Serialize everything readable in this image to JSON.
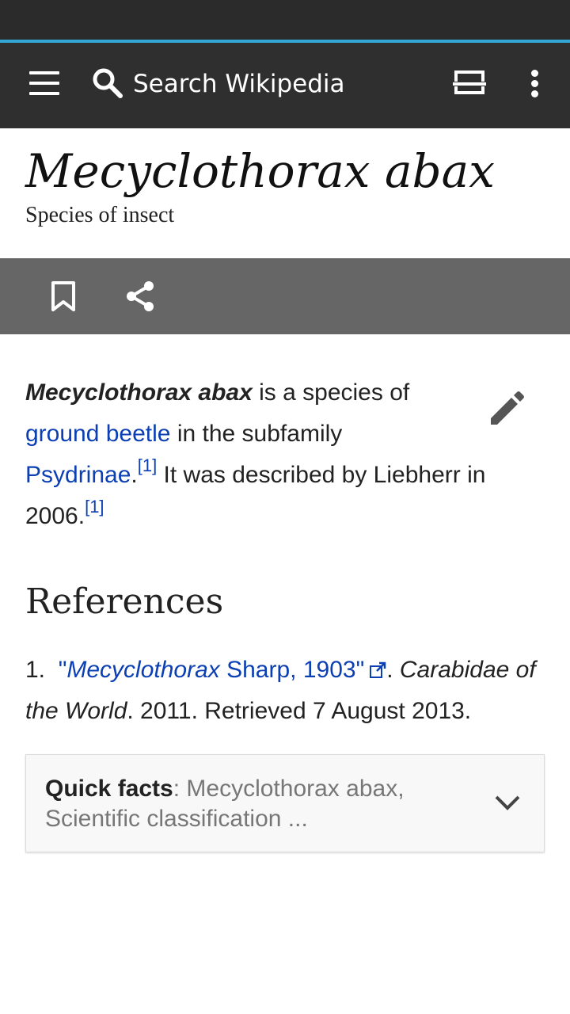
{
  "toolbar": {
    "search_placeholder": "Search Wikipedia"
  },
  "article": {
    "title": "Mecyclothorax abax",
    "description": "Species of insect",
    "intro": {
      "bold_name": "Mecyclothorax abax",
      "text1": " is a species of",
      "link_ground_beetle": "ground beetle",
      "text2": " in the subfamily",
      "link_psydrinae": "Psydrinae",
      "period1": ".",
      "cite1": "[1]",
      "text3": " It was described by Liebherr in",
      "year": "2006.",
      "cite2": "[1]"
    }
  },
  "references": {
    "heading": "References",
    "items": [
      {
        "number": "1.",
        "link_quote_open": "\"",
        "link_italic": "Mecyclothorax",
        "link_rest": " Sharp, 1903\"",
        "sep": ". ",
        "work_part1": "Carabidae of",
        "work_part2": "the World",
        "details": ". 2011. Retrieved 7 August 2013."
      }
    ]
  },
  "quick_facts": {
    "label": "Quick facts",
    "separator": ": ",
    "summary_line1": "Mecyclothorax abax,",
    "summary_line2": "Scientific classification ..."
  },
  "colors": {
    "toolbar_bg": "#2f2f2f",
    "progress_accent": "#33a5d6",
    "action_bar_bg": "#666666",
    "link": "#0b3fb3"
  }
}
